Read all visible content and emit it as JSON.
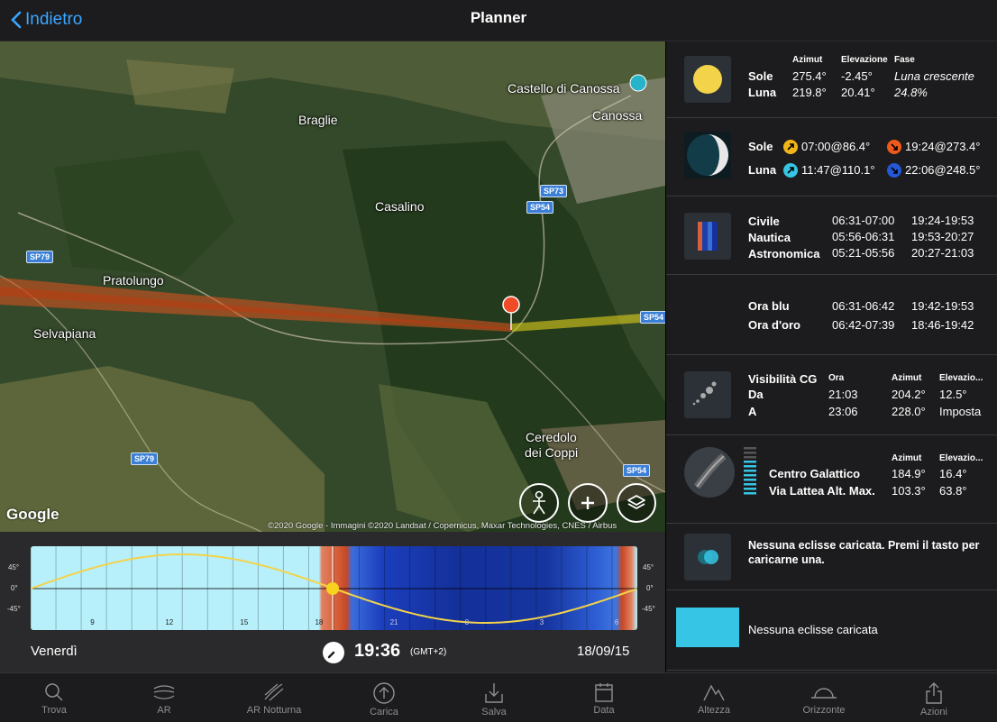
{
  "nav": {
    "back_label": "Indietro",
    "title": "Planner"
  },
  "map": {
    "labels": {
      "castello": "Castello di Canossa",
      "canossa": "Canossa",
      "braglie": "Braglie",
      "casalino": "Casalino",
      "pratolungo": "Pratolungo",
      "selvapiana": "Selvapiana",
      "ceredolo_1": "Ceredolo",
      "ceredolo_2": "dei Coppi"
    },
    "roads": {
      "sp73": "SP73",
      "sp54_a": "SP54",
      "sp79_a": "SP79",
      "sp79_b": "SP79",
      "sp54_b": "SP54",
      "sp54_c": "SP54"
    },
    "google_logo": "Google",
    "attribution": "©2020 Google - Immagini ©2020 Landsat / Copernicus, Maxar Technologies, CNES / Airbus"
  },
  "timeline": {
    "y_ticks": [
      "45°",
      "0°",
      "-45°"
    ],
    "x_ticks": [
      "9",
      "12",
      "15",
      "18",
      "21",
      "0",
      "3",
      "6"
    ],
    "day": "Venerdì",
    "time": "19:36",
    "timezone": "(GMT+2)",
    "date": "18/09/15",
    "colors": {
      "day": "#b7f0fb",
      "night": "#14309a",
      "twilight": "#d6603a",
      "sun_curve": "#f3d34a"
    }
  },
  "panel": {
    "sun_moon": {
      "headers": {
        "azimut": "Azimut",
        "elevazione": "Elevazione",
        "fase": "Fase"
      },
      "sole": {
        "label": "Sole",
        "azimut": "275.4°",
        "elevazione": "-2.45°"
      },
      "luna": {
        "label": "Luna",
        "azimut": "219.8°",
        "elevazione": "20.41°"
      },
      "phase_name": "Luna crescente",
      "phase_pct": "24.8%"
    },
    "rise_set": {
      "sole_label": "Sole",
      "sole_rise": "07:00@86.4°",
      "sole_set": "19:24@273.4°",
      "luna_label": "Luna",
      "luna_rise": "11:47@110.1°",
      "luna_set": "22:06@248.5°"
    },
    "twilight": {
      "civile": {
        "label": "Civile",
        "am": "06:31-07:00",
        "pm": "19:24-19:53"
      },
      "nautica": {
        "label": "Nautica",
        "am": "05:56-06:31",
        "pm": "19:53-20:27"
      },
      "astronomica": {
        "label": "Astronomica",
        "am": "05:21-05:56",
        "pm": "20:27-21:03"
      }
    },
    "hours": {
      "blu": {
        "label": "Ora blu",
        "am": "06:31-06:42",
        "pm": "19:42-19:53"
      },
      "oro": {
        "label": "Ora d'oro",
        "am": "06:42-07:39",
        "pm": "18:46-19:42"
      }
    },
    "gc_visibility": {
      "title": "Visibilità CG",
      "headers": {
        "ora": "Ora",
        "azimut": "Azimut",
        "elevazione": "Elevazio..."
      },
      "da": {
        "label": "Da",
        "ora": "21:03",
        "azimut": "204.2°",
        "elevazione": "12.5°"
      },
      "a": {
        "label": "A",
        "ora": "23:06",
        "azimut": "228.0°",
        "elevazione": "Imposta"
      }
    },
    "galactic": {
      "headers": {
        "azimut": "Azimut",
        "elevazione": "Elevazio..."
      },
      "centro": {
        "label": "Centro Galattico",
        "azimut": "184.9°",
        "elevazione": "16.4°"
      },
      "via_lattea": {
        "label": "Via Lattea Alt. Max.",
        "azimut": "103.3°",
        "elevazione": "63.8°"
      }
    },
    "eclipse": {
      "message": "Nessuna eclisse caricata. Premi il tasto per caricarne una.",
      "none": "Nessuna eclisse caricata"
    }
  },
  "tabs": [
    {
      "label": "Trova",
      "icon": "search-icon"
    },
    {
      "label": "AR",
      "icon": "ar-icon"
    },
    {
      "label": "AR Notturna",
      "icon": "ar-night-icon"
    },
    {
      "label": "Carica",
      "icon": "upload-circle-icon"
    },
    {
      "label": "Salva",
      "icon": "download-icon"
    },
    {
      "label": "Data",
      "icon": "calendar-icon"
    },
    {
      "label": "Altezza",
      "icon": "mountain-icon"
    },
    {
      "label": "Orizzonte",
      "icon": "horizon-icon"
    },
    {
      "label": "Azioni",
      "icon": "share-icon"
    }
  ]
}
